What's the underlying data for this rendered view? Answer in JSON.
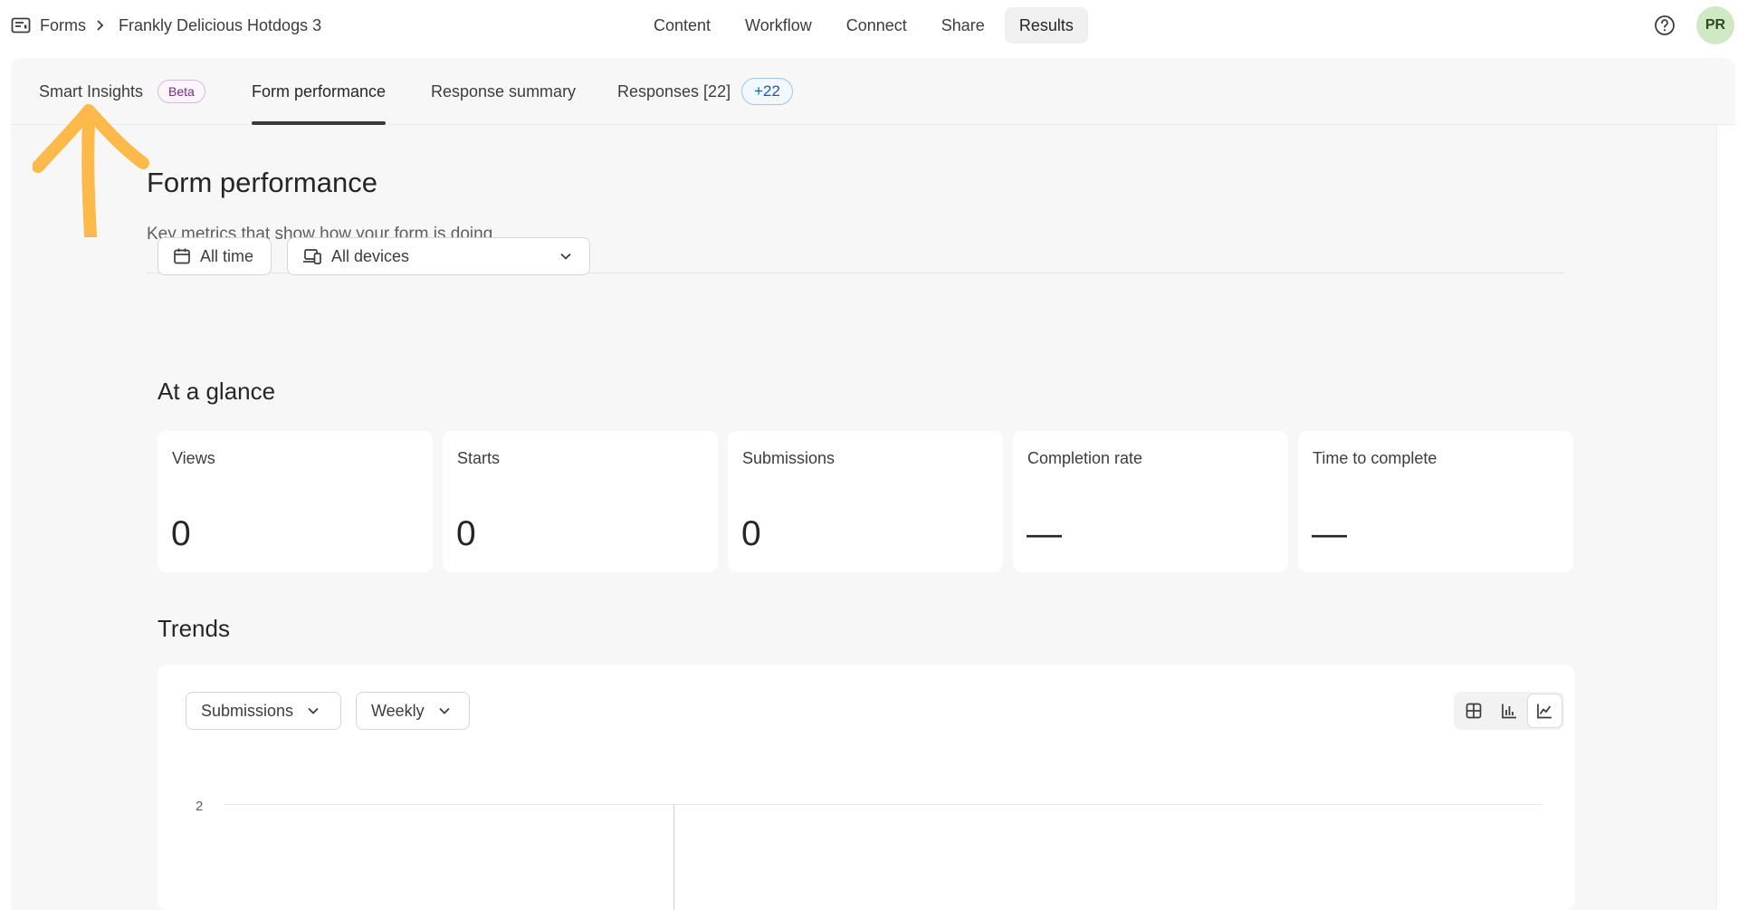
{
  "breadcrumb": {
    "root": "Forms",
    "current": "Frankly Delicious Hotdogs 3"
  },
  "nav": [
    {
      "label": "Content"
    },
    {
      "label": "Workflow"
    },
    {
      "label": "Connect"
    },
    {
      "label": "Share"
    },
    {
      "label": "Results",
      "active": true
    }
  ],
  "user": {
    "initials": "PR"
  },
  "tabs": {
    "smart_insights": "Smart Insights",
    "beta": "Beta",
    "form_performance": "Form performance",
    "response_summary": "Response summary",
    "responses": "Responses [22]",
    "responses_badge": "+22",
    "active": "form_performance"
  },
  "page": {
    "title": "Form performance",
    "subtitle": "Key metrics that show how your form is doing."
  },
  "filters": {
    "date": "All time",
    "device": "All devices"
  },
  "glance": {
    "title": "At a glance",
    "metrics": [
      {
        "label": "Views",
        "value": "0"
      },
      {
        "label": "Starts",
        "value": "0"
      },
      {
        "label": "Submissions",
        "value": "0"
      },
      {
        "label": "Completion rate",
        "value": "—"
      },
      {
        "label": "Time to complete",
        "value": "—"
      }
    ]
  },
  "trends": {
    "title": "Trends",
    "metric_select": "Submissions",
    "period_select": "Weekly",
    "view_modes": [
      "table-icon",
      "bar-chart-icon",
      "line-chart-icon"
    ],
    "active_view": "line-chart-icon",
    "y_tick": "2"
  },
  "colors": {
    "arrow": "#FDB94A",
    "avatar_bg": "#CFE9C4"
  }
}
